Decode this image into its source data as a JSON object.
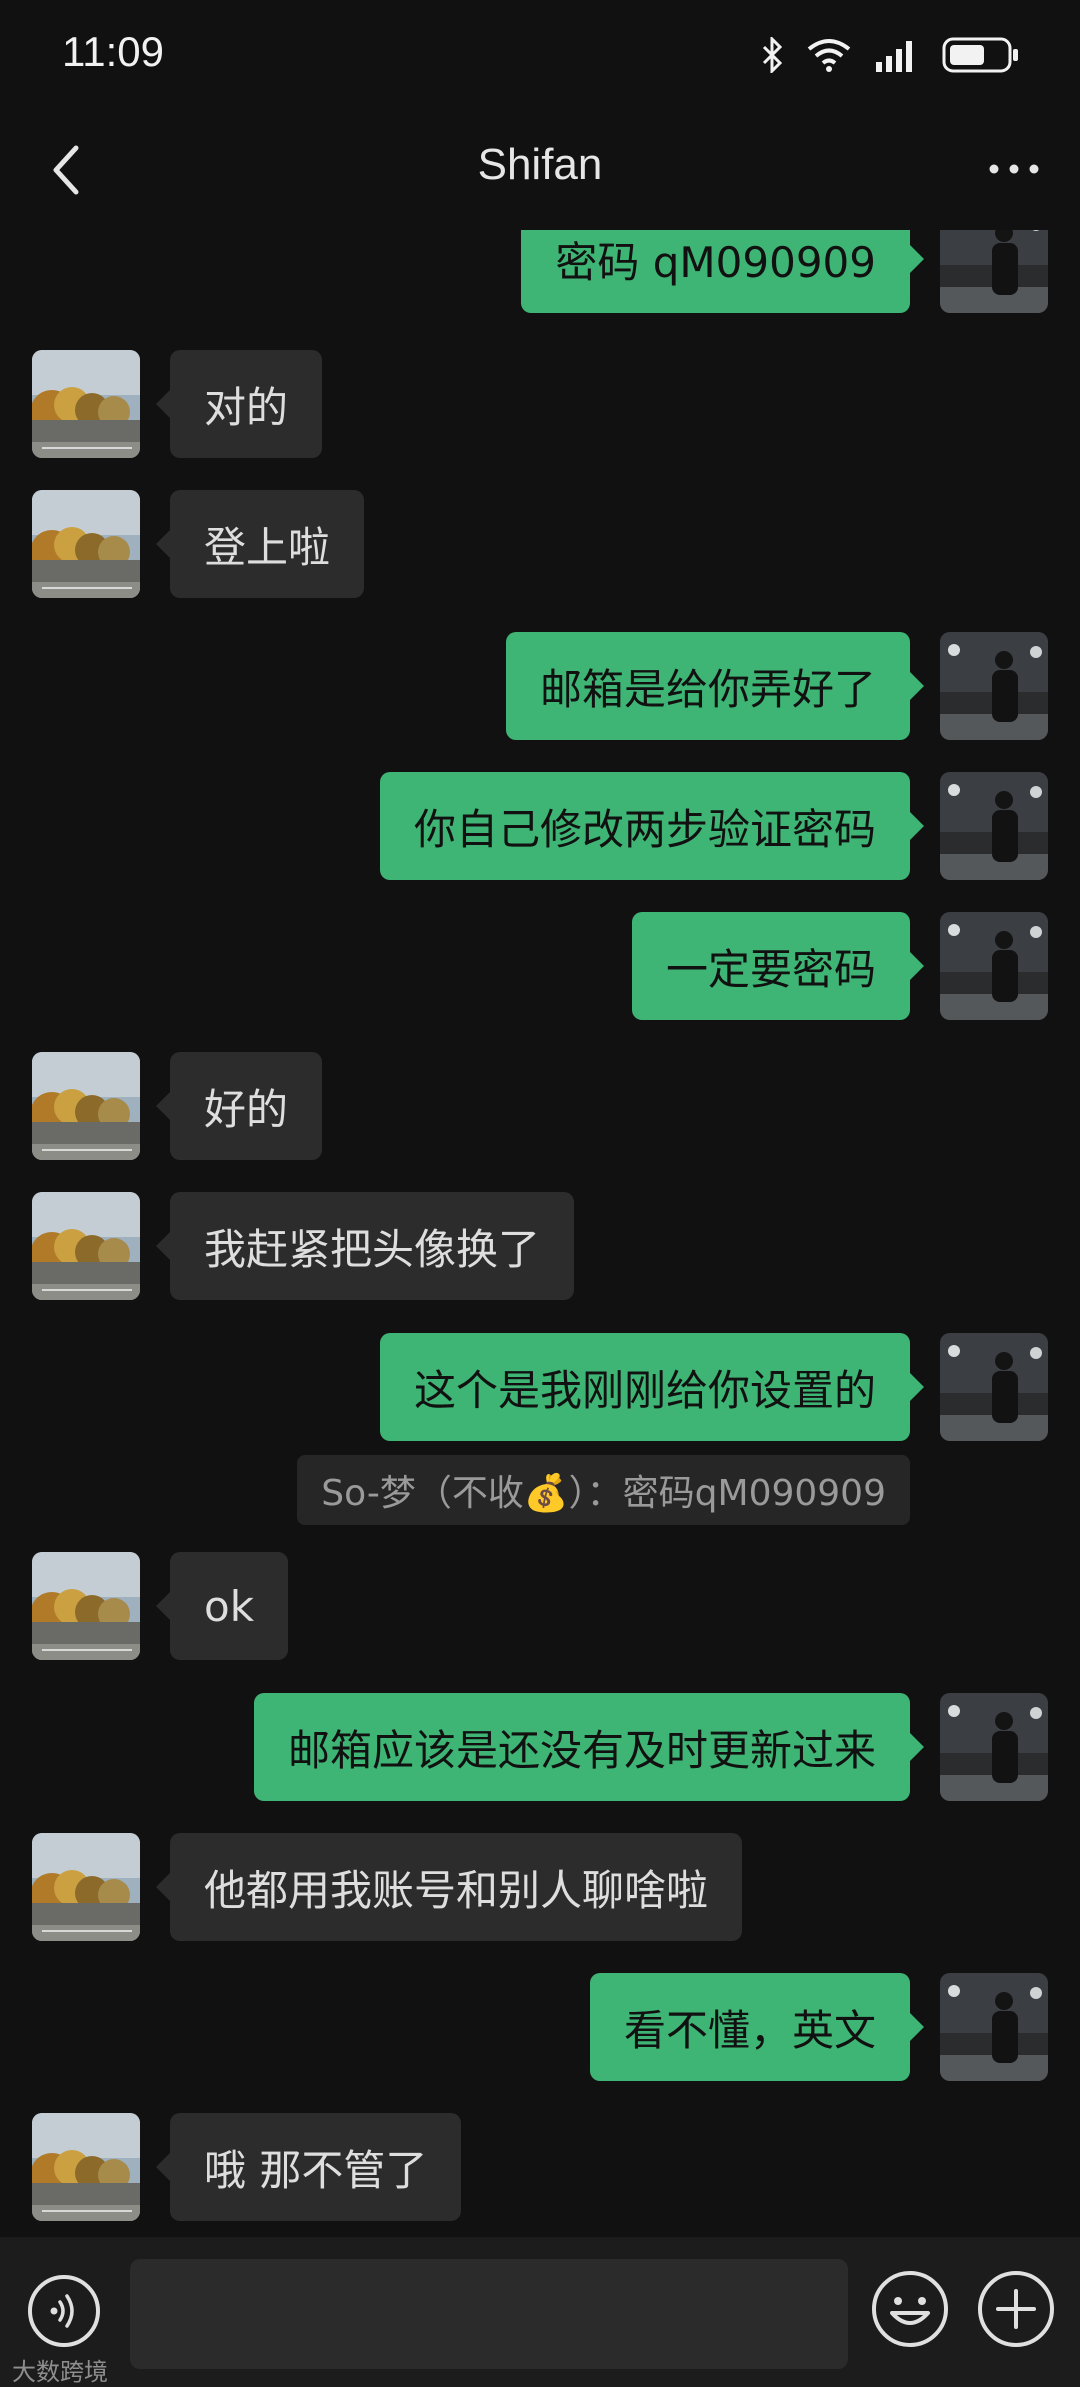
{
  "status_bar": {
    "time": "11:09"
  },
  "header": {
    "title": "Shifan"
  },
  "messages": [
    {
      "side": "out",
      "text": "密码 qM090909"
    },
    {
      "side": "in",
      "text": "对的"
    },
    {
      "side": "in",
      "text": "登上啦"
    },
    {
      "side": "out",
      "text": "邮箱是给你弄好了"
    },
    {
      "side": "out",
      "text": "你自己修改两步验证密码"
    },
    {
      "side": "out",
      "text": "一定要密码"
    },
    {
      "side": "in",
      "text": "好的"
    },
    {
      "side": "in",
      "text": "我赶紧把头像换了"
    },
    {
      "side": "out",
      "text": "这个是我刚刚给你设置的"
    },
    {
      "side": "in",
      "text": "ok"
    },
    {
      "side": "out",
      "text": "邮箱应该是还没有及时更新过来"
    },
    {
      "side": "in",
      "text": "他都用我账号和别人聊啥啦"
    },
    {
      "side": "out",
      "text": "看不懂，英文"
    },
    {
      "side": "in",
      "text": "哦 那不管了"
    }
  ],
  "quote": {
    "text": "So-梦（不收💰）：密码qM090909"
  },
  "watermark": {
    "text": "大数跨境"
  },
  "colors": {
    "outgoing_bubble": "#3eb575",
    "incoming_bubble": "#2c2c2c",
    "background": "#111111"
  },
  "icons": [
    "bluetooth-icon",
    "wifi-icon",
    "signal-icon",
    "battery-icon",
    "back-icon",
    "more-icon",
    "voice-icon",
    "emoji-icon",
    "plus-icon"
  ]
}
